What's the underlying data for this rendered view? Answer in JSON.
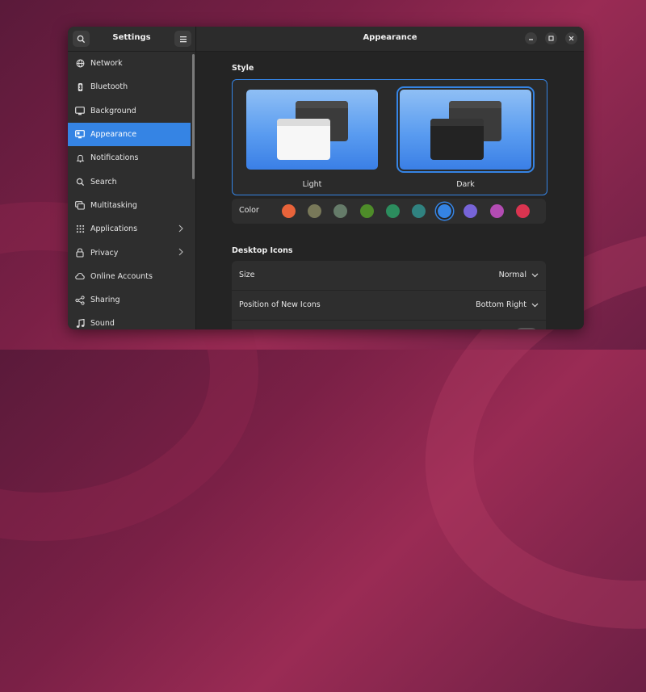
{
  "sidebar": {
    "title": "Settings",
    "items": [
      {
        "label": "Network",
        "icon": "network-icon"
      },
      {
        "label": "Bluetooth",
        "icon": "bluetooth-icon"
      },
      {
        "label": "Background",
        "icon": "background-icon"
      },
      {
        "label": "Appearance",
        "icon": "appearance-icon",
        "active": true
      },
      {
        "label": "Notifications",
        "icon": "bell-icon"
      },
      {
        "label": "Search",
        "icon": "search-icon"
      },
      {
        "label": "Multitasking",
        "icon": "multitasking-icon"
      },
      {
        "label": "Applications",
        "icon": "applications-icon",
        "submenu": true
      },
      {
        "label": "Privacy",
        "icon": "lock-icon",
        "submenu": true
      },
      {
        "label": "Online Accounts",
        "icon": "cloud-icon"
      },
      {
        "label": "Sharing",
        "icon": "share-icon"
      },
      {
        "label": "Sound",
        "icon": "music-note-icon"
      }
    ]
  },
  "header": {
    "title": "Appearance"
  },
  "style": {
    "title": "Style",
    "themes": [
      {
        "label": "Light",
        "selected": false
      },
      {
        "label": "Dark",
        "selected": true
      }
    ]
  },
  "color": {
    "label": "Color",
    "swatches": [
      "#e8633a",
      "#787859",
      "#657b69",
      "#4e8c29",
      "#2c8d5e",
      "#308280",
      "#3584e4",
      "#7764d8",
      "#b34cb3",
      "#da3450"
    ],
    "selected_index": 6
  },
  "desktop_icons": {
    "title": "Desktop Icons",
    "rows": [
      {
        "label": "Size",
        "value": "Normal"
      },
      {
        "label": "Position of New Icons",
        "value": "Bottom Right"
      }
    ]
  },
  "colors": {
    "accent": "#3584e4"
  }
}
